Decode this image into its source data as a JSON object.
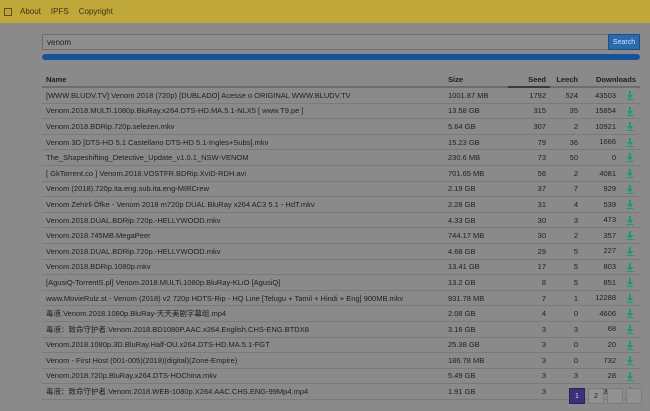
{
  "nav": {
    "links": [
      "About",
      "IPFS",
      "Copyright"
    ]
  },
  "search": {
    "query": "venom",
    "button_label": "Search",
    "progress": 1.0
  },
  "colors": {
    "navbar": "#c0a73a",
    "accent": "#2a6bb0",
    "progress": "#17539d",
    "download_icon": "#1a9a7a",
    "pager_active": "#3d2f78"
  },
  "table": {
    "columns": [
      "Name",
      "Size",
      "Seed",
      "Leech",
      "Downloads"
    ],
    "download_icon": "download-arrow-icon",
    "rows": [
      [
        "[WWW.BLUDV.TV] Venom 2018 (720p) [DUBLADO] Acesse o ORIGINAL WWW.BLUDV.TV",
        "1001.87 MB",
        "1792",
        "524",
        "43503"
      ],
      [
        "Venom.2018.MULTi.1080p.BluRay.x264.DTS-HD.MA.5.1-NLX5 [ www.T9.pe ]",
        "13.58 GB",
        "315",
        "35",
        "15854"
      ],
      [
        "Venom.2018.BDRip.720p.selezen.mkv",
        "5.64 GB",
        "307",
        "2",
        "10921"
      ],
      [
        "Venom 3D [DTS-HD 5.1 Castellano DTS-HD 5.1-Ingles+Subs].mkv",
        "15.23 GB",
        "79",
        "36",
        "1666"
      ],
      [
        "The_Shapeshifting_Detective_Update_v1.0.1_NSW-VENOM",
        "230.6 MB",
        "73",
        "50",
        "0"
      ],
      [
        "[ GkTorrent.co ] Venom.2018.VOSTFR.BDRip.XviD-RDH.avi",
        "701.65 MB",
        "56",
        "2",
        "4081"
      ],
      [
        "Venom (2018).720p.ita.eng.sub.ita.eng-MIRCrew",
        "2.19 GB",
        "37",
        "7",
        "929"
      ],
      [
        "Venom Zehirli Öfke - Venom 2018 m720p DUAL BluRay x264 AC3 5.1 - HdT.mkv",
        "2.28 GB",
        "31",
        "4",
        "539"
      ],
      [
        "Venom.2018.DUAL.BDRip.720p.-HELLYWOOD.mkv",
        "4.33 GB",
        "30",
        "3",
        "473"
      ],
      [
        "Venom.2018.745MB.MegaPeer",
        "744.17 MB",
        "30",
        "2",
        "357"
      ],
      [
        "Venom.2018.DUAL.BDRip.720p.-HELLYWOOD.mkv",
        "4.68 GB",
        "29",
        "5",
        "227"
      ],
      [
        "Venom.2018.BDRip.1080p.mkv",
        "13.41 GB",
        "17",
        "5",
        "803"
      ],
      [
        "[AgusiQ-TorrentS.pl] Venom.2018.MULTi.1080p.BluRay-KLiO [AgusiQ]",
        "13.2 GB",
        "8",
        "5",
        "851"
      ],
      [
        "www.MovieRulz.st - Venom (2018) v2 720p HDTS-Rip - HQ Line [Telugu + Tamil + Hindi + Eng] 900MB.mkv",
        "931.78 MB",
        "7",
        "1",
        "12288"
      ],
      [
        "毒液.Venom.2018.1080p.BluRay-天天美剧字幕组.mp4",
        "2.08 GB",
        "4",
        "0",
        "4606"
      ],
      [
        "毒液：致命守护者.Venom.2018.BD1080P.AAC.x264.English.CHS-ENG.BTDX8",
        "3.16 GB",
        "3",
        "3",
        "68"
      ],
      [
        "Venom.2018.1080p.3D.BluRay.Half-OU.x264.DTS-HD.MA.5.1-FGT",
        "25.38 GB",
        "3",
        "0",
        "20"
      ],
      [
        "Venom - First Host (001-005)(2018)(digital)(Zone-Empire)",
        "186.78 MB",
        "3",
        "0",
        "732"
      ],
      [
        "Venom.2018.720p.BluRay.x264.DTS-HDChina.mkv",
        "5.49 GB",
        "3",
        "3",
        "28"
      ],
      [
        "毒液：致命守护者.Venom.2018.WEB-1080p.X264.AAC.CHS.ENG-99Mp4.mp4",
        "1.91 GB",
        "3",
        "0",
        "338"
      ]
    ]
  },
  "pagination": {
    "pages": [
      "1",
      "2",
      "",
      ""
    ],
    "active": "1"
  }
}
